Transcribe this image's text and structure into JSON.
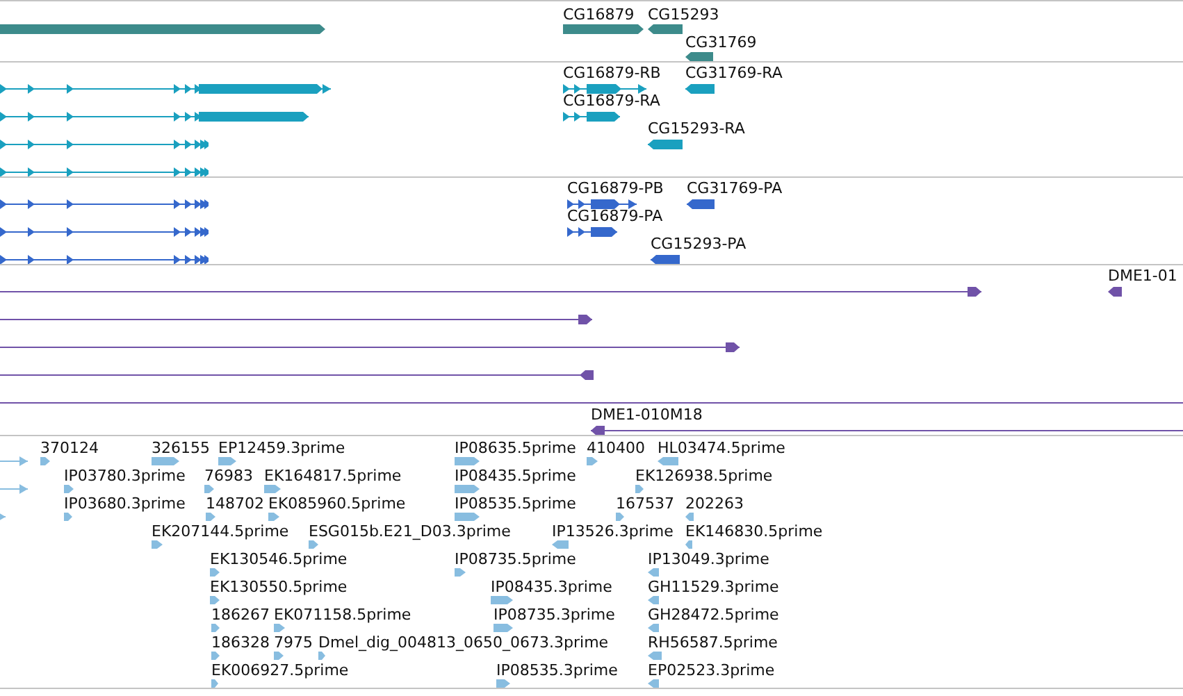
{
  "tracks": [
    {
      "kind": "gene",
      "color": "#3d8b8b",
      "features": [
        {
          "reverse": false
        },
        {
          "label": "CG16879",
          "reverse": false
        },
        {
          "label": "CG15293",
          "reverse": true
        },
        {
          "label": "CG31769",
          "reverse": true
        }
      ]
    },
    {
      "kind": "transcript",
      "color": "#1aa0bf",
      "features": [
        {
          "reverse": false
        },
        {
          "reverse": false
        },
        {
          "reverse": false
        },
        {
          "reverse": false
        },
        {
          "label": "CG16879-RB",
          "reverse": false
        },
        {
          "label": "CG31769-RA",
          "reverse": true
        },
        {
          "label": "CG16879-RA",
          "reverse": false
        },
        {
          "label": "CG15293-RA",
          "reverse": true
        }
      ]
    },
    {
      "kind": "protein",
      "color": "#3568cc",
      "features": [
        {
          "reverse": false
        },
        {
          "reverse": false
        },
        {
          "reverse": false
        },
        {
          "label": "CG16879-PB",
          "reverse": false
        },
        {
          "label": "CG31769-PA",
          "reverse": true
        },
        {
          "label": "CG16879-PA",
          "reverse": false
        },
        {
          "label": "CG15293-PA",
          "reverse": true
        }
      ]
    },
    {
      "kind": "clone",
      "color": "#7052a8",
      "features": [
        {
          "kind": "arrow",
          "reverse": false
        },
        {
          "label": "DME1-01",
          "kind": "arrow",
          "reverse": true
        },
        {
          "kind": "arrow",
          "reverse": false
        },
        {
          "kind": "arrow",
          "reverse": false
        },
        {
          "kind": "arrow",
          "reverse": true
        },
        {
          "kind": "line"
        },
        {
          "label": "DME1-010M18",
          "kind": "arrow",
          "reverse": true
        }
      ]
    },
    {
      "kind": "est",
      "color": "#88bde0",
      "features": [
        {
          "reverse": false
        },
        {
          "reverse": false
        },
        {
          "reverse": false
        },
        {
          "label": "370124",
          "reverse": false
        },
        {
          "label": "326155",
          "reverse": false
        },
        {
          "label": "EP12459.3prime",
          "reverse": false
        },
        {
          "label": "IP08635.5prime",
          "reverse": false
        },
        {
          "label": "410400",
          "reverse": false
        },
        {
          "label": "HL03474.5prime",
          "reverse": true
        },
        {
          "label": "IP03780.3prime",
          "reverse": false
        },
        {
          "label": "76983",
          "reverse": false
        },
        {
          "label": "EK164817.5prime",
          "reverse": false
        },
        {
          "label": "IP08435.5prime",
          "reverse": false
        },
        {
          "label": "EK126938.5prime",
          "reverse": false
        },
        {
          "label": "IP03680.3prime",
          "reverse": false
        },
        {
          "label": "148702",
          "reverse": false
        },
        {
          "label": "EK085960.5prime",
          "reverse": false
        },
        {
          "label": "IP08535.5prime",
          "reverse": false
        },
        {
          "label": "167537",
          "reverse": false
        },
        {
          "label": "202263",
          "reverse": true
        },
        {
          "label": "EK207144.5prime",
          "reverse": false
        },
        {
          "label": "ESG015b.E21_D03.3prime",
          "reverse": false
        },
        {
          "label": "IP13526.3prime",
          "reverse": true
        },
        {
          "label": "EK146830.5prime",
          "reverse": true
        },
        {
          "label": "EK130546.5prime",
          "reverse": false
        },
        {
          "label": "IP08735.5prime",
          "reverse": false
        },
        {
          "label": "IP13049.3prime",
          "reverse": true
        },
        {
          "label": "EK130550.5prime",
          "reverse": false
        },
        {
          "label": "IP08435.3prime",
          "reverse": false
        },
        {
          "label": "GH11529.3prime",
          "reverse": true
        },
        {
          "label": "186267",
          "reverse": false
        },
        {
          "label": "EK071158.5prime",
          "reverse": false
        },
        {
          "label": "IP08735.3prime",
          "reverse": false
        },
        {
          "label": "GH28472.5prime",
          "reverse": true
        },
        {
          "label": "186328",
          "reverse": false
        },
        {
          "label": "7975",
          "reverse": false
        },
        {
          "label": "Dmel_dig_004813_0650_0673.3prime",
          "reverse": false
        },
        {
          "label": "RH56587.5prime",
          "reverse": true
        },
        {
          "label": "EK006927.5prime",
          "reverse": false
        },
        {
          "label": "IP08535.3prime",
          "reverse": false
        },
        {
          "label": "EP02523.3prime",
          "reverse": true
        }
      ]
    }
  ]
}
